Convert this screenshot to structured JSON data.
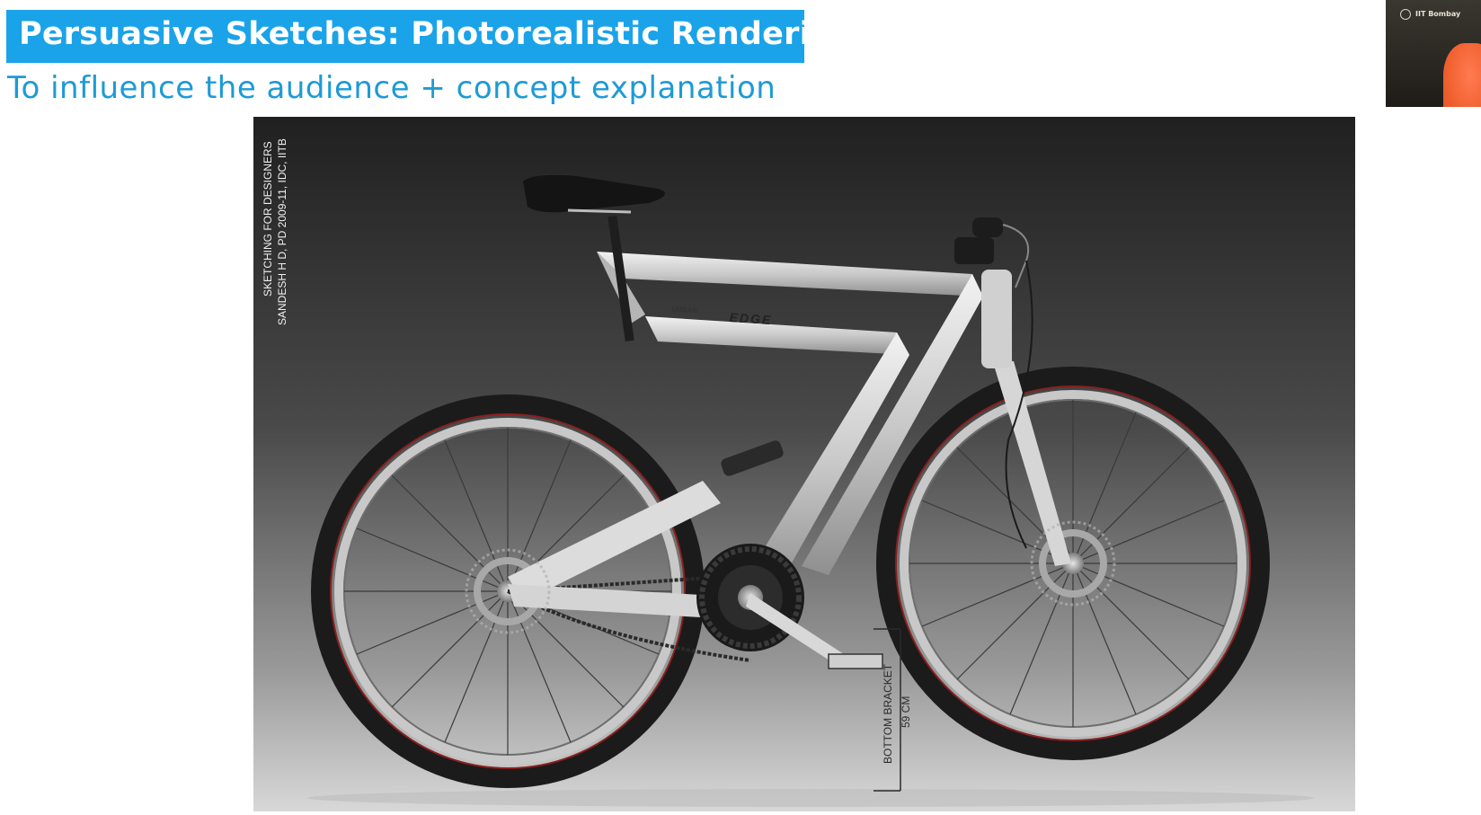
{
  "slide": {
    "title": "Persuasive Sketches: Photorealistic Renderings",
    "subtitle": "To influence the audience + concept explanation"
  },
  "image": {
    "credit_line_1": "SKETCHING FOR DESIGNERS",
    "credit_line_2": "SANDESH H D, PD 2009-11, IDC, IITB",
    "brand_small": "URBAN",
    "brand_large": "EDGE",
    "dimension_label": "BOTTOM BRACKET",
    "dimension_value": "59 CM"
  },
  "webcam": {
    "label": "IIT Bombay"
  },
  "colors": {
    "title_bar": "#1aa3e8",
    "subtitle": "#1e9ad6"
  }
}
